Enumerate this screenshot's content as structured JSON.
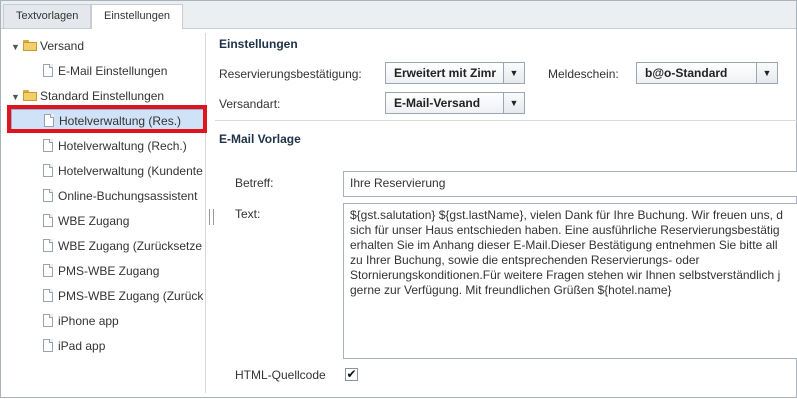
{
  "tabs": [
    {
      "label": "Textvorlagen"
    },
    {
      "label": "Einstellungen"
    }
  ],
  "sidebar": {
    "items": [
      {
        "label": "Versand",
        "type": "folder",
        "expanded": true
      },
      {
        "label": "E-Mail Einstellungen",
        "type": "page"
      },
      {
        "label": "Standard Einstellungen",
        "type": "folder",
        "expanded": true
      },
      {
        "label": "Hotelverwaltung (Res.)",
        "type": "page",
        "selected": true
      },
      {
        "label": "Hotelverwaltung (Rech.)",
        "type": "page"
      },
      {
        "label": "Hotelverwaltung (Kundente",
        "type": "page"
      },
      {
        "label": "Online-Buchungsassistent",
        "type": "page"
      },
      {
        "label": "WBE Zugang",
        "type": "page"
      },
      {
        "label": "WBE Zugang (Zurücksetze",
        "type": "page"
      },
      {
        "label": "PMS-WBE Zugang",
        "type": "page"
      },
      {
        "label": "PMS-WBE Zugang (Zurück",
        "type": "page"
      },
      {
        "label": "iPhone app",
        "type": "page"
      },
      {
        "label": "iPad app",
        "type": "page"
      }
    ]
  },
  "settings": {
    "title": "Einstellungen",
    "reservation_label": "Reservierungsbestätigung:",
    "reservation_value": "Erweitert mit Zimr",
    "meldeschein_label": "Meldeschein:",
    "meldeschein_value": "b@o-Standard",
    "versandart_label": "Versandart:",
    "versandart_value": "E-Mail-Versand"
  },
  "email": {
    "title": "E-Mail Vorlage",
    "subject_label": "Betreff:",
    "subject_value": "Ihre Reservierung",
    "text_label": "Text:",
    "text_value": "${gst.salutation} ${gst.lastName}, vielen Dank für Ihre Buchung. Wir freuen uns, d\nsich für unser Haus entschieden haben. Eine ausführliche Reservierungsbestätig\nerhalten Sie im Anhang dieser E-Mail.Dieser Bestätigung entnehmen Sie bitte all\nzu Ihrer Buchung, sowie die entsprechenden Reservierungs- oder\nStornierungskonditionen.Für weitere Fragen stehen wir Ihnen selbstverständlich j\ngerne zur Verfügung. Mit freundlichen Grüßen ${hotel.name}",
    "html_label": "HTML-Quellcode",
    "html_checked": "✔"
  },
  "icons": {
    "dropdown": "chevron-down-icon",
    "expand": "triangle-down-icon",
    "folder": "folder-open-icon",
    "page": "document-icon"
  },
  "colors": {
    "selection": "#cfe2f7",
    "highlight_border": "#e0141e"
  }
}
